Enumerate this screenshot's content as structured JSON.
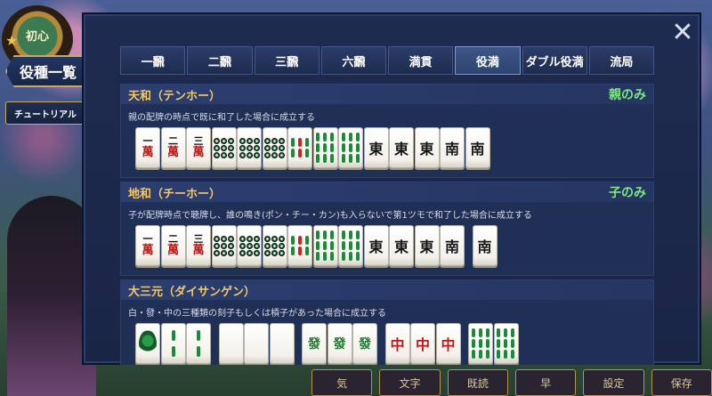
{
  "background": {
    "logo_label": "初心",
    "bottom_buttons": [
      "気",
      "文字",
      "既読",
      "早",
      "設定",
      "",
      "保存"
    ]
  },
  "side": {
    "title": "役種一覧",
    "tutorial": "チュートリアル"
  },
  "tabs": [
    {
      "label": "一飜",
      "active": false
    },
    {
      "label": "二飜",
      "active": false
    },
    {
      "label": "三飜",
      "active": false
    },
    {
      "label": "六飜",
      "active": false
    },
    {
      "label": "満貫",
      "active": false
    },
    {
      "label": "役満",
      "active": true
    },
    {
      "label": "ダブル役満",
      "active": false
    },
    {
      "label": "流局",
      "active": false
    }
  ],
  "close_symbol": "✕",
  "yaku": [
    {
      "name": "天和（テンホー）",
      "tag": "親のみ",
      "description": "親の配牌の時点で既に和了した場合に成立する"
    },
    {
      "name": "地和（チーホー）",
      "tag": "子のみ",
      "description": "子が配牌時点で聴牌し、誰の鳴き(ポン・チー・カン)も入らないで第1ツモで和了した場合に成立する"
    },
    {
      "name": "大三元（ダイサンゲン）",
      "tag": "",
      "description": "白・發・中の三種類の刻子もしくは槓子があった場合に成立する"
    }
  ],
  "tile_text": {
    "one": "一",
    "two": "二",
    "three": "三",
    "man": "萬",
    "east": "東",
    "south": "南",
    "chun": "中",
    "hatsu": "發"
  },
  "colors": {
    "tag_green": "#7bea7d",
    "yaku_gold": "#f2c86b",
    "man_red": "#b31a1a"
  }
}
